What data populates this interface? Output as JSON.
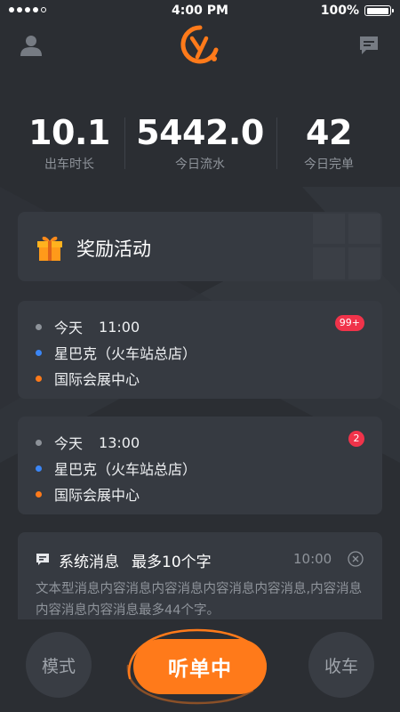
{
  "status_bar": {
    "time": "4:00 PM",
    "battery": "100%",
    "battery_level": 1.0
  },
  "header": {
    "profile_icon": "person-icon",
    "message_icon": "message-icon",
    "logo_icon": "y-logo-icon"
  },
  "stats": [
    {
      "value": "10.1",
      "label": "出车时长"
    },
    {
      "value": "5442.0",
      "label": "今日流水"
    },
    {
      "value": "42",
      "label": "今日完单"
    }
  ],
  "reward": {
    "title": "奖励活动",
    "icon": "gift-icon"
  },
  "orders": [
    {
      "day": "今天",
      "time": "11:00",
      "from": "星巴克（火车站总店）",
      "to": "国际会展中心",
      "badge": "99+"
    },
    {
      "day": "今天",
      "time": "13:00",
      "from": "星巴克（火车站总店）",
      "to": "国际会展中心",
      "badge": "2"
    }
  ],
  "system_message": {
    "title": "系统消息",
    "subtitle": "最多10个字",
    "time": "10:00",
    "body": "文本型消息内容消息内容消息内容消息内容消息,内容消息内容消息内容消息最多44个字。"
  },
  "bottom": {
    "mode_label": "模式",
    "listen_label": "听单中",
    "stop_label": "收车"
  },
  "colors": {
    "background": "#2b2e33",
    "card": "#363a41",
    "accent": "#ff7a1a",
    "badge": "#f0334a",
    "blue_dot": "#3b86f6",
    "muted_text": "#8e939a"
  }
}
